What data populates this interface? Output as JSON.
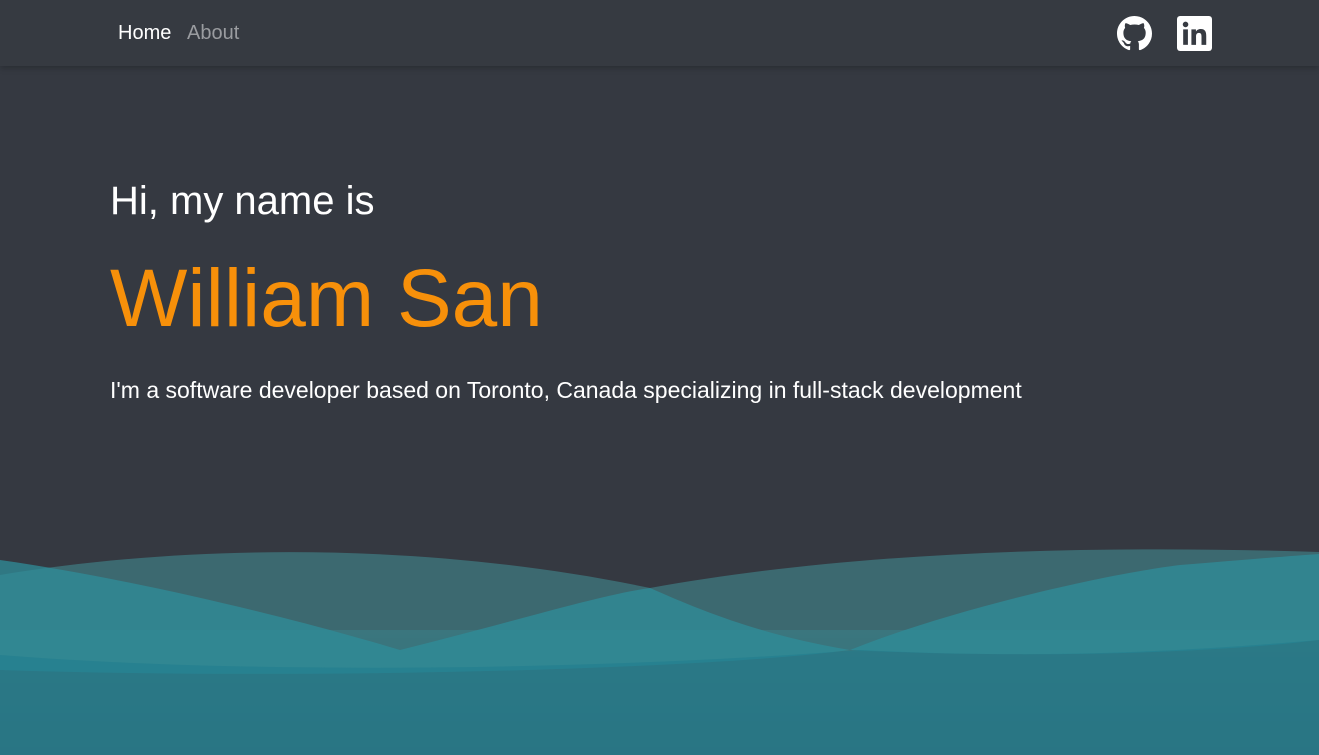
{
  "nav": {
    "home_label": "Home",
    "about_label": "About"
  },
  "social": {
    "github_icon": "github-icon",
    "linkedin_icon": "linkedin-icon"
  },
  "hero": {
    "greeting": "Hi, my name is",
    "name": "William San",
    "tagline": "I'm a software developer based on Toronto, Canada specializing in full-stack development"
  },
  "colors": {
    "background": "#353941",
    "accent": "#f7900a",
    "nav_inactive": "#9a9ca0",
    "wave": "#2b8596"
  }
}
